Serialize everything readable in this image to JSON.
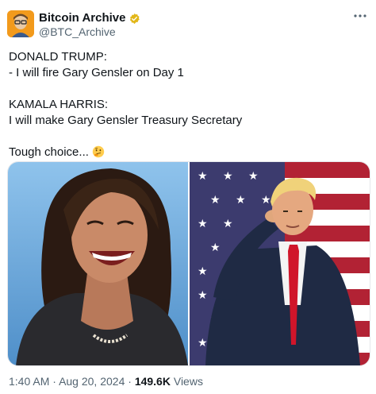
{
  "author": {
    "display_name": "Bitcoin Archive",
    "handle": "@BTC_Archive"
  },
  "tweet": {
    "lines": [
      "DONALD TRUMP:",
      "- I will fire Gary Gensler on Day 1",
      "",
      "KAMALA HARRIS:",
      "I will make Gary Gensler Treasury Secretary",
      "",
      "Tough choice..."
    ]
  },
  "meta": {
    "time": "1:40 AM",
    "separator": "·",
    "date": "Aug 20, 2024",
    "views_count": "149.6K",
    "views_label": "Views"
  },
  "icons": {
    "verified": "verified-badge-icon",
    "more": "more-options-icon",
    "emoji": "thinking-face-icon"
  },
  "colors": {
    "verified_badge": "#e2b719",
    "muted_text": "#536471",
    "flag_red": "#b22234",
    "flag_blue": "#3c3b6e"
  }
}
